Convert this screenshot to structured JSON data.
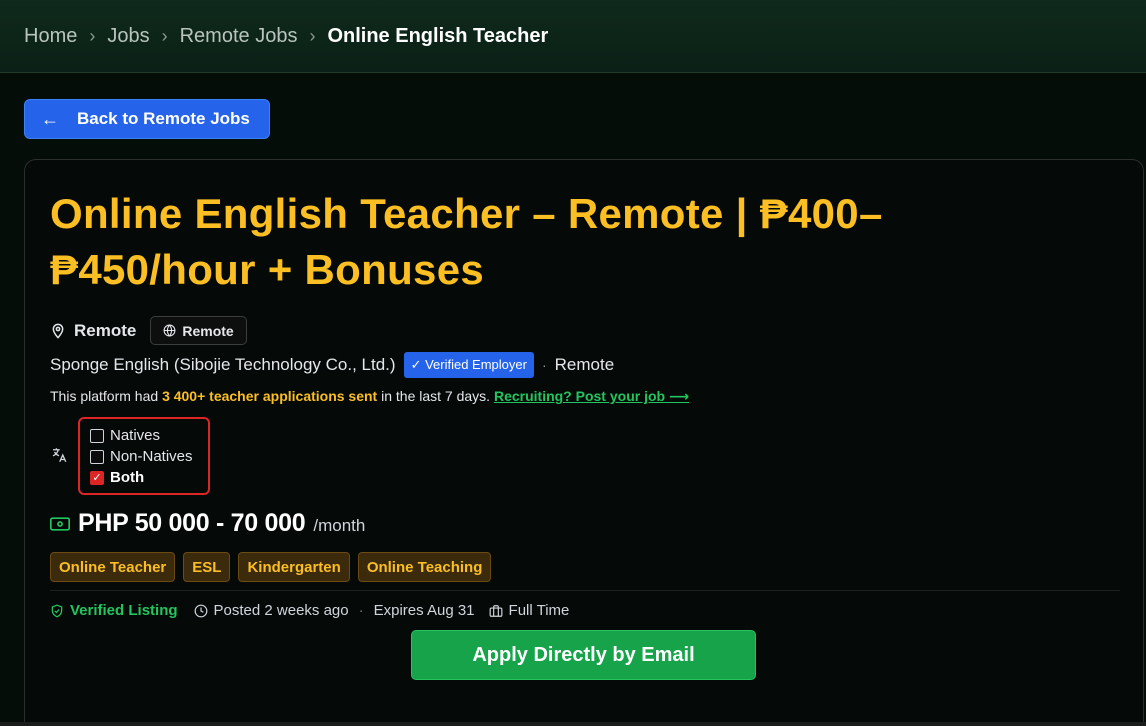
{
  "breadcrumb": {
    "items": [
      "Home",
      "Jobs",
      "Remote Jobs"
    ],
    "current": "Online English Teacher",
    "separator": "›"
  },
  "back_button": {
    "label": "Back to Remote Jobs",
    "icon": "arrow-left-icon"
  },
  "job": {
    "title": "Online English Teacher – Remote | ₱400–₱450/hour + Bonuses",
    "location": "Remote",
    "location_chip": "Remote",
    "company": "Sponge English (Sibojie Technology Co., Ltd.)",
    "verified_badge": "✓ Verified Employer",
    "company_separator": "·",
    "company_location": "Remote",
    "platform": {
      "prefix": "This platform had ",
      "highlight": "3 400+ teacher applications sent",
      "suffix": " in the last 7 days. ",
      "link": "Recruiting? Post your job ⟶"
    },
    "languages": [
      {
        "label": "Natives",
        "checked": false
      },
      {
        "label": "Non-Natives",
        "checked": false
      },
      {
        "label": "Both",
        "checked": true
      }
    ],
    "salary": "PHP 50 000 - 70 000",
    "salary_period": "/month",
    "tags": [
      "Online Teacher",
      "ESL",
      "Kindergarten",
      "Online Teaching"
    ],
    "meta": {
      "verified": "Verified Listing",
      "posted": "Posted 2 weeks ago",
      "separator": "·",
      "expires": "Expires Aug 31",
      "type": "Full Time"
    },
    "apply_label": "Apply Directly by Email"
  },
  "colors": {
    "accent_gold": "#fbbf24",
    "primary_blue": "#2563eb",
    "success_green": "#16a34a",
    "alert_red": "#dc2626"
  }
}
